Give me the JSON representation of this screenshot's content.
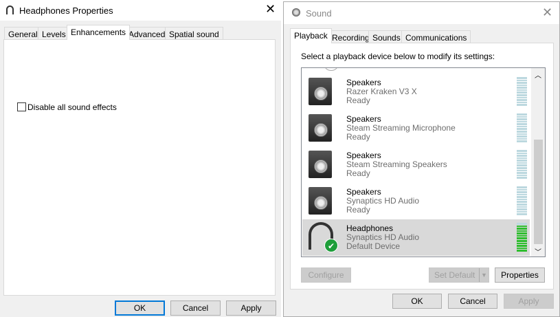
{
  "props": {
    "title": "Headphones Properties",
    "tabs": [
      "General",
      "Levels",
      "Enhancements",
      "Advanced",
      "Spatial sound"
    ],
    "active_tab": "Enhancements",
    "checkbox_label": "Disable all sound effects",
    "checkbox_checked": false,
    "ok": "OK",
    "cancel": "Cancel",
    "apply": "Apply"
  },
  "sound": {
    "title": "Sound",
    "tabs": [
      "Playback",
      "Recording",
      "Sounds",
      "Communications"
    ],
    "active_tab": "Playback",
    "instruction": "Select a playback device below to modify its settings:",
    "devices": [
      {
        "name": "Speakers",
        "driver": "Razer Kraken V3 X",
        "status": "Ready",
        "level": 0
      },
      {
        "name": "Speakers",
        "driver": "Steam Streaming Microphone",
        "status": "Ready",
        "level": 0
      },
      {
        "name": "Speakers",
        "driver": "Steam Streaming Speakers",
        "status": "Ready",
        "level": 0
      },
      {
        "name": "Speakers",
        "driver": "Synaptics HD Audio",
        "status": "Ready",
        "level": 0
      },
      {
        "name": "Headphones",
        "driver": "Synaptics HD Audio",
        "status": "Default Device",
        "level": 0.92,
        "selected": true
      }
    ],
    "configure": "Configure",
    "set_default": "Set Default",
    "properties": "Properties",
    "ok": "OK",
    "cancel": "Cancel",
    "apply": "Apply"
  },
  "colors": {
    "meter_on": "#2ebd2e",
    "meter_off": "#bcd8df",
    "accent": "#0078d7",
    "default_check": "#1e9e3a"
  }
}
